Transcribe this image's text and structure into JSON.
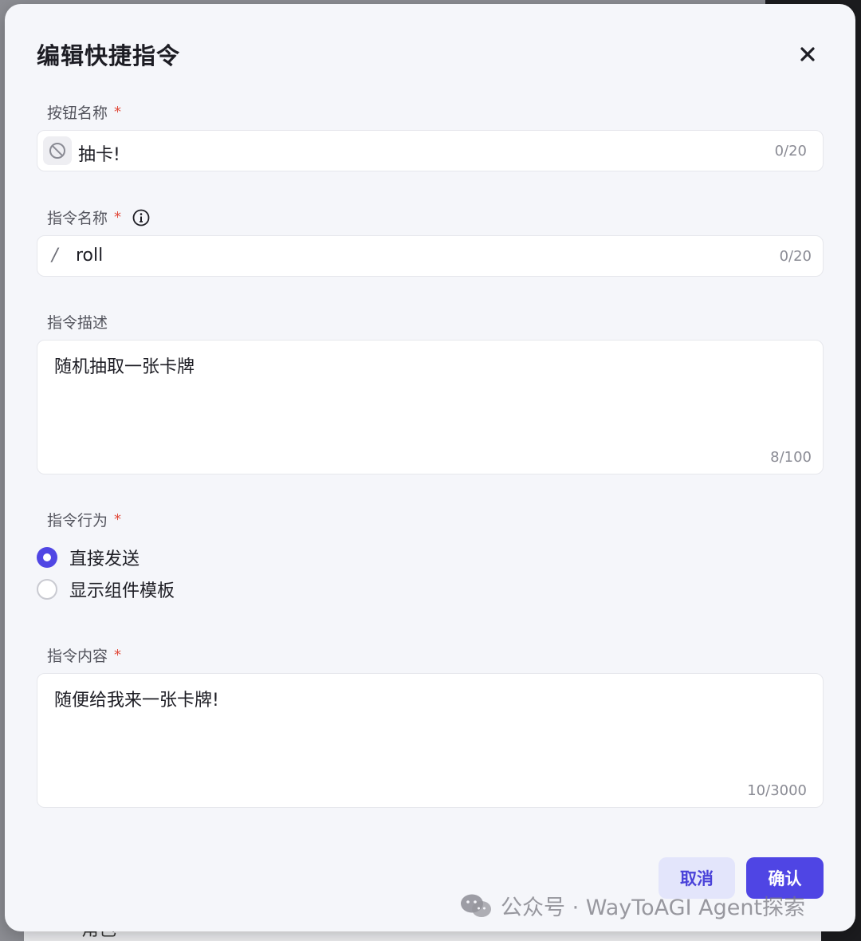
{
  "dialog": {
    "title": "编辑快捷指令",
    "close_icon": "close-icon"
  },
  "button_name": {
    "label": "按钮名称",
    "required_mark": "*",
    "icon": "no-emoji-icon",
    "value": "抽卡!",
    "counter": "0/20"
  },
  "command_name": {
    "label": "指令名称",
    "required_mark": "*",
    "info_icon": "info-icon",
    "prefix": "/",
    "value": "roll",
    "counter": "0/20"
  },
  "command_desc": {
    "label": "指令描述",
    "value": "随机抽取一张卡牌",
    "counter": "8/100"
  },
  "command_behavior": {
    "label": "指令行为",
    "required_mark": "*",
    "options": [
      {
        "label": "直接发送",
        "checked": true
      },
      {
        "label": "显示组件模板",
        "checked": false
      }
    ]
  },
  "command_content": {
    "label": "指令内容",
    "required_mark": "*",
    "value": "随便给我来一张卡牌!",
    "counter": "10/3000"
  },
  "footer": {
    "cancel_label": "取消",
    "confirm_label": "确认"
  },
  "watermark": {
    "text": "公众号 · WayToAGI Agent探索"
  },
  "backdrop": {
    "hint_text": "角色"
  },
  "colors": {
    "accent": "#4f45e4",
    "required": "#e14a3a",
    "dialog_bg": "#f5f6fa"
  }
}
